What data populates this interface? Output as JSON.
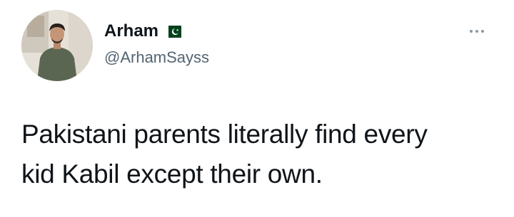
{
  "author": {
    "display_name": "Arham",
    "handle": "@ArhamSayss",
    "flag_icon": "pakistan-flag-icon",
    "avatar_icon": "profile-photo"
  },
  "menu": {
    "icon": "more-options-icon"
  },
  "tweet": {
    "text_line1": "Pakistani parents literally find every",
    "text_line2": "kid Kabil except their own."
  },
  "colors": {
    "text": "#0f1419",
    "secondary": "#536471",
    "flag_green": "#01411c",
    "background": "#ffffff"
  }
}
